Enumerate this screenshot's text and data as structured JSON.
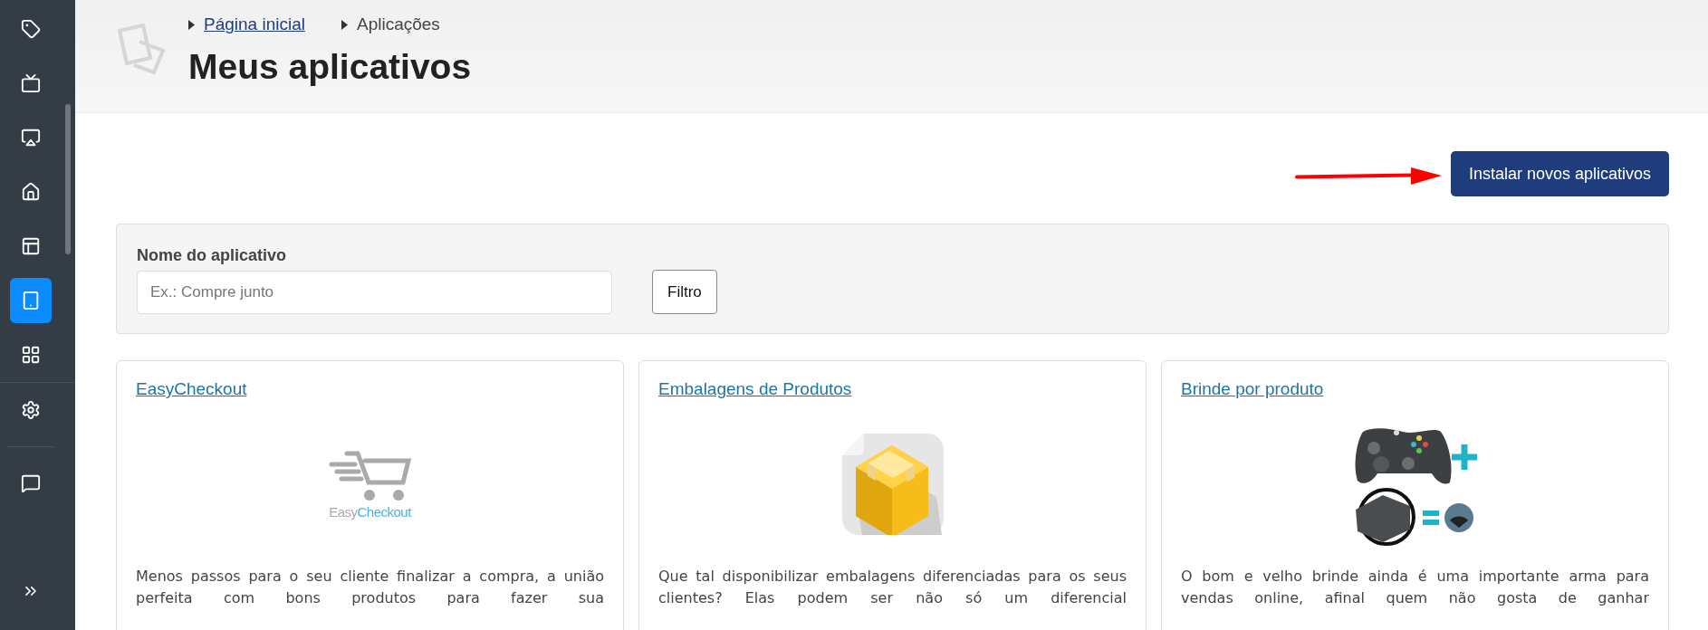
{
  "sidebar": {
    "items": [
      {
        "kind": "tag",
        "selected": false
      },
      {
        "kind": "tv",
        "selected": false
      },
      {
        "kind": "airplay",
        "selected": false
      },
      {
        "kind": "home",
        "selected": false
      },
      {
        "kind": "layout",
        "selected": false
      },
      {
        "kind": "tablet",
        "selected": true
      },
      {
        "kind": "grid",
        "selected": false
      },
      {
        "kind": "divider"
      },
      {
        "kind": "settings",
        "selected": false
      },
      {
        "kind": "short-divider"
      },
      {
        "kind": "help",
        "selected": false
      }
    ]
  },
  "breadcrumb": [
    {
      "label": "Página inicial",
      "link": true
    },
    {
      "label": "Aplicações",
      "link": false
    }
  ],
  "page_title": "Meus aplicativos",
  "install_button": "Instalar novos aplicativos",
  "filter": {
    "label": "Nome do aplicativo",
    "placeholder": "Ex.: Compre junto",
    "button": "Filtro"
  },
  "cards": [
    {
      "title": "EasyCheckout",
      "kind": "cart",
      "logo_text": [
        "Easy",
        "Checkout"
      ],
      "description": "Menos passos para o seu cliente finalizar a compra, a união perfeita com bons produtos para fazer sua"
    },
    {
      "title": "Embalagens de Produtos",
      "kind": "box",
      "description": "Que tal disponibilizar embalagens diferenciadas para os seus clientes? Elas podem ser não só um diferencial"
    },
    {
      "title": "Brinde por produto",
      "kind": "gift",
      "description": "O bom e velho brinde ainda é uma importante arma para vendas online, afinal quem não gosta de ganhar"
    }
  ]
}
